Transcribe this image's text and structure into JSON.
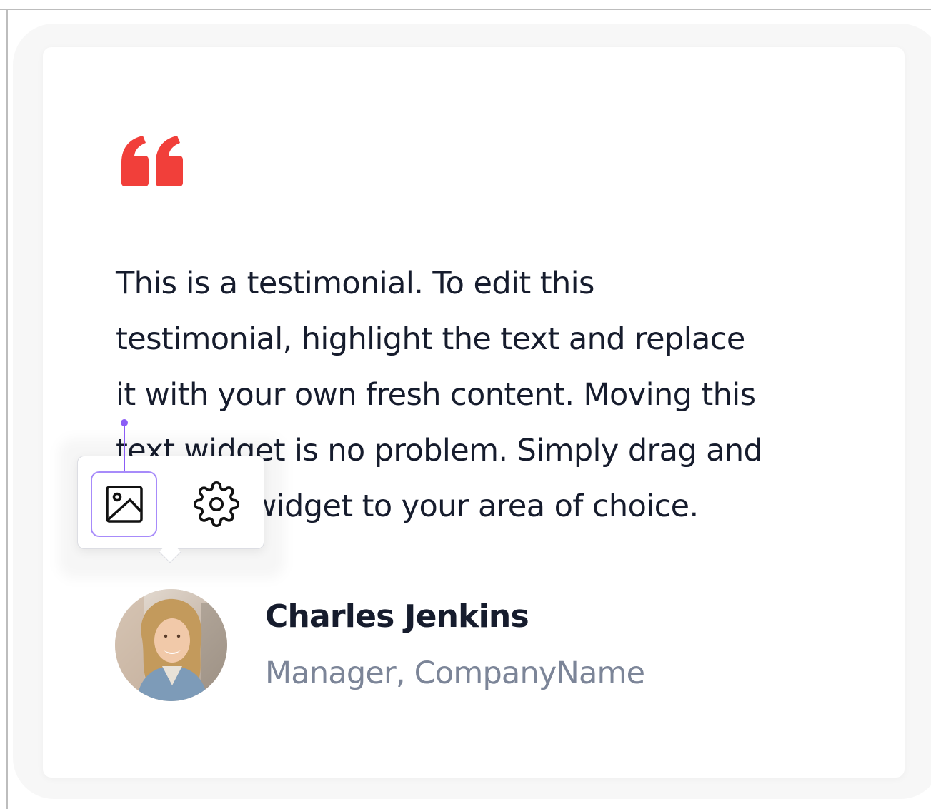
{
  "testimonial": {
    "quote_text": "This is a testimonial. To edit this\ntestimonial, highlight the text and replace\nit with your own fresh content. Moving this\ntext widget is no problem. Simply drag and\ndrop the widget to your area of choice.",
    "author_name": "Charles Jenkins",
    "author_title": "Manager, CompanyName"
  },
  "toolbar": {
    "image_icon": "image-icon",
    "settings_icon": "gear-icon"
  },
  "colors": {
    "quote_mark": "#f13f3a",
    "selection_accent": "#8b5cf6",
    "text_primary": "#161c2d",
    "text_secondary": "#7c8598"
  }
}
